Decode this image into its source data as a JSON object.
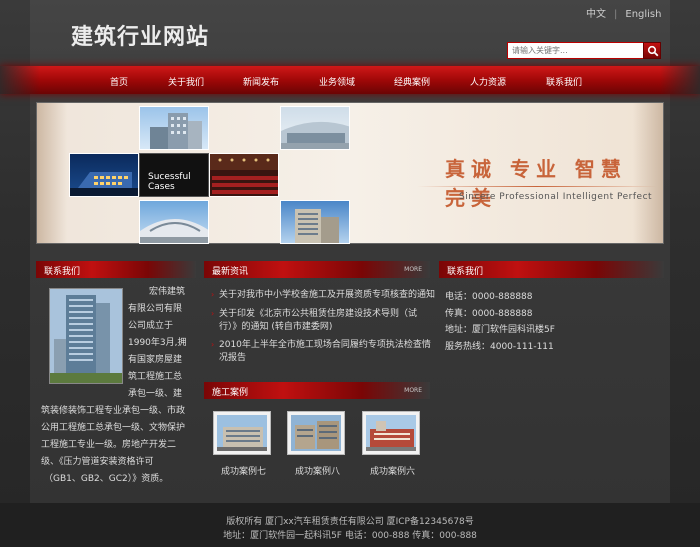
{
  "site": {
    "title": "建筑行业网站"
  },
  "lang": {
    "zh": "中文",
    "sep": "|",
    "en": "English"
  },
  "search": {
    "placeholder": "请输入关键字..."
  },
  "nav": {
    "items": [
      {
        "label": "首页"
      },
      {
        "label": "关于我们"
      },
      {
        "label": "新闻发布"
      },
      {
        "label": "业务领域"
      },
      {
        "label": "经典案例"
      },
      {
        "label": "人力资源"
      },
      {
        "label": "联系我们"
      }
    ]
  },
  "banner": {
    "caption": "Sucessful Cases",
    "slogan": "真诚 专业 智慧 完美",
    "subtitle": "Sincere Professional Intelligent Perfect"
  },
  "about": {
    "heading": "联系我们",
    "lines": [
      "宏伟建筑",
      "有限公司有限",
      "公司成立于",
      "1990年3月,拥",
      "有国家房屋建",
      "筑工程施工总",
      "承包一级、建",
      "筑装修装饰工程专业承包一级、市政",
      "公用工程施工总承包一级、文物保护",
      "工程施工专业一级。房地产开发二",
      "级、《压力管道安装资格许可",
      "（GB1、GB2、GC2）》资质。"
    ]
  },
  "news": {
    "heading": "最新资讯",
    "more": "MORE",
    "items": [
      {
        "line1": "关于对我市中小学校舍施工及开展资质专项核查的通知",
        "line2": ""
      },
      {
        "line1": "关于印发《北京市公共租赁住房建设技术导则（试",
        "line2": "行）》的通知 (转自市建委网)"
      },
      {
        "line1": "2010年上半年全市施工现场合同履约专项执法检查情",
        "line2": "况报告"
      }
    ]
  },
  "cases": {
    "heading": "施工案例",
    "more": "MORE",
    "items": [
      {
        "label": "成功案例七"
      },
      {
        "label": "成功案例八"
      },
      {
        "label": "成功案例六"
      }
    ]
  },
  "contact": {
    "heading": "联系我们",
    "phone": "电话：0000-888888",
    "fax": "传真：0000-888888",
    "address": "地址：厦门软件园科讯楼5F",
    "hotline": "服务热线：4000-111-111"
  },
  "footer": {
    "line1": "版权所有 厦门xx汽车租赁责任有限公司 厦ICP备12345678号",
    "line2": "地址：厦门软件园一起科讯5F 电话：000-888 传真：000-888"
  }
}
